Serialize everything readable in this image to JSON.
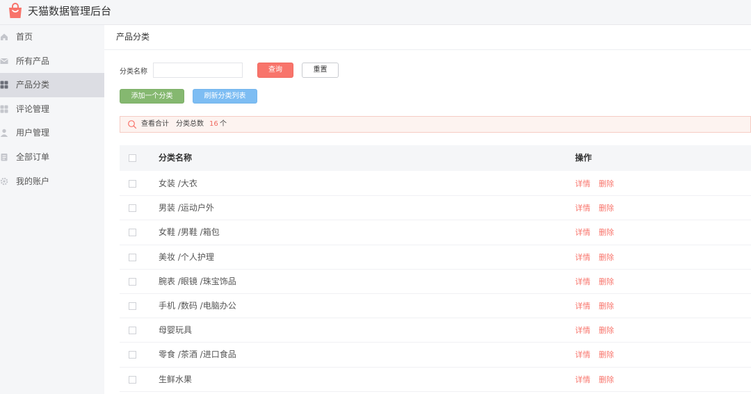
{
  "app": {
    "title": "天猫数据管理后台",
    "logo_icon": "shopping-bag-icon",
    "brand_color": "#f8746b"
  },
  "sidebar": {
    "items": [
      {
        "label": "首页",
        "icon": "home-icon",
        "active": false
      },
      {
        "label": "所有产品",
        "icon": "mail-icon",
        "active": false
      },
      {
        "label": "产品分类",
        "icon": "grid-icon",
        "active": true
      },
      {
        "label": "评论管理",
        "icon": "grid-icon",
        "active": false
      },
      {
        "label": "用户管理",
        "icon": "user-icon",
        "active": false
      },
      {
        "label": "全部订单",
        "icon": "clipboard-icon",
        "active": false
      },
      {
        "label": "我的账户",
        "icon": "gear-icon",
        "active": false
      }
    ]
  },
  "main": {
    "breadcrumb": "产品分类",
    "search": {
      "label": "分类名称",
      "value": "",
      "placeholder": ""
    },
    "buttons": {
      "query": "查询",
      "reset": "重置",
      "add": "添加一个分类",
      "refresh": "刷新分类列表"
    },
    "summary": {
      "text": "查看合计",
      "label": "分类总数",
      "count": "16",
      "unit": "个"
    },
    "table": {
      "headers": {
        "name": "分类名称",
        "op": "操作"
      },
      "rows": [
        {
          "name": "女装 /大衣"
        },
        {
          "name": "男装 /运动户外"
        },
        {
          "name": "女鞋 /男鞋 /箱包"
        },
        {
          "name": "美妆 /个人护理"
        },
        {
          "name": "腕表 /眼镜 /珠宝饰品"
        },
        {
          "name": "手机 /数码 /电脑办公"
        },
        {
          "name": "母婴玩具"
        },
        {
          "name": "零食 /茶酒 /进口食品"
        },
        {
          "name": "生鲜水果"
        }
      ],
      "actions": {
        "detail": "详情",
        "delete": "删除"
      }
    }
  }
}
